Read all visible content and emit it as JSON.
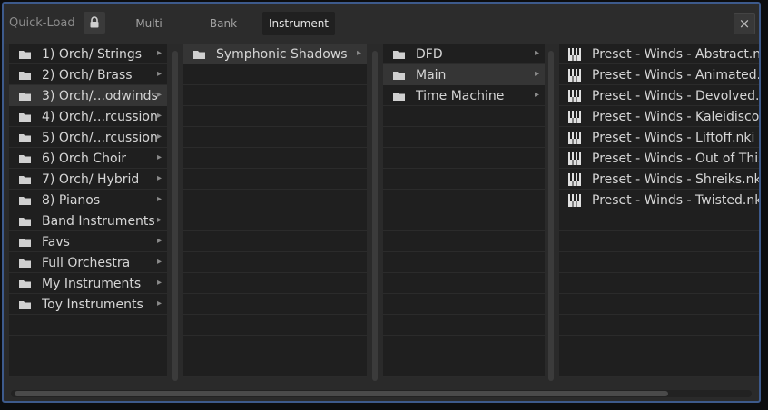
{
  "header": {
    "title": "Quick-Load",
    "lock_icon": "lock-icon",
    "tabs": [
      {
        "label": "Multi"
      },
      {
        "label": "Bank"
      },
      {
        "label": "Instrument",
        "active": true
      }
    ],
    "close_label": "×"
  },
  "column1": {
    "items": [
      {
        "label": "1) Orch/ Strings"
      },
      {
        "label": "2) Orch/ Brass"
      },
      {
        "label": "3) Orch/...odwinds",
        "selected": true
      },
      {
        "label": "4) Orch/...rcussion"
      },
      {
        "label": "5) Orch/...rcussion"
      },
      {
        "label": "6) Orch Choir"
      },
      {
        "label": "7) Orch/ Hybrid"
      },
      {
        "label": "8) Pianos"
      },
      {
        "label": "Band Instruments"
      },
      {
        "label": "Favs"
      },
      {
        "label": "Full Orchestra"
      },
      {
        "label": "My Instruments"
      },
      {
        "label": "Toy Instruments"
      }
    ]
  },
  "column2": {
    "items": [
      {
        "label": "Symphonic Shadows",
        "selected": true
      }
    ]
  },
  "column3": {
    "items": [
      {
        "label": "DFD"
      },
      {
        "label": "Main",
        "selected": true
      },
      {
        "label": "Time Machine"
      }
    ]
  },
  "column4": {
    "items": [
      {
        "label": "Preset - Winds - Abstract.nki"
      },
      {
        "label": "Preset - Winds - Animated.nki"
      },
      {
        "label": "Preset - Winds - Devolved.nki"
      },
      {
        "label": "Preset - Winds - Kaleidiscope.nki"
      },
      {
        "label": "Preset - Winds - Liftoff.nki"
      },
      {
        "label": "Preset - Winds - Out of This World.nki"
      },
      {
        "label": "Preset - Winds - Shreiks.nki"
      },
      {
        "label": "Preset - Winds - Twisted.nki"
      }
    ]
  },
  "icons": {
    "folder": "folder-icon",
    "chevron": "chevron-right-icon",
    "instrument": "piano-keys-icon"
  },
  "colors": {
    "window_border": "#3d5a8c",
    "panel_bg": "#1f1f1f",
    "text": "#d6d6d6"
  }
}
